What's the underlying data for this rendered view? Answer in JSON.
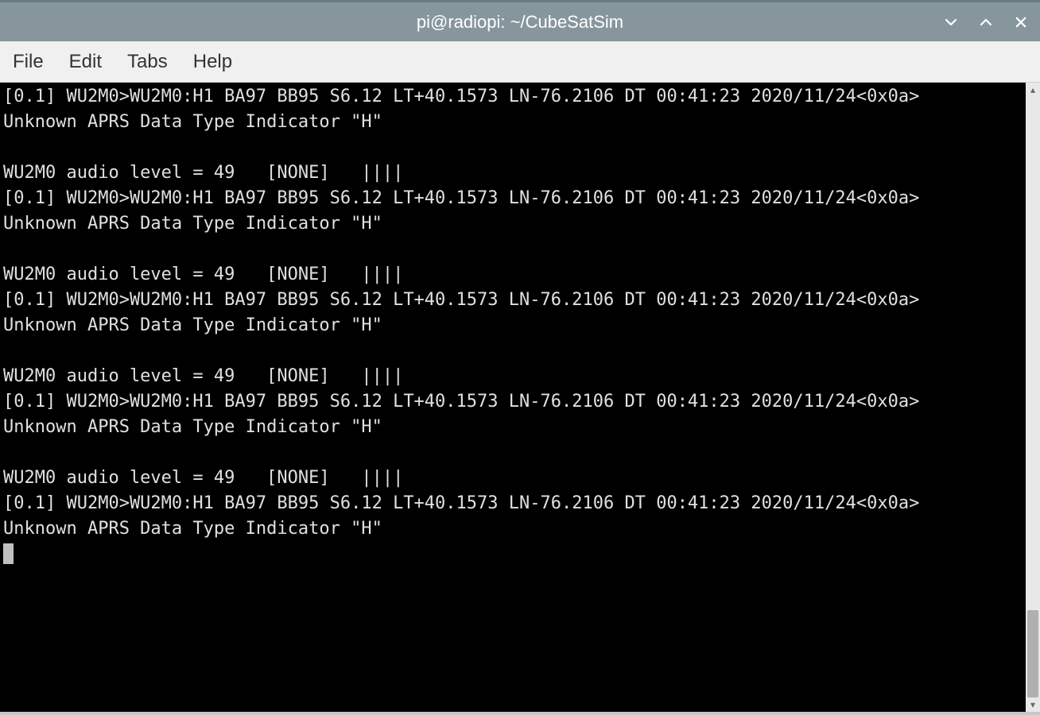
{
  "window": {
    "title": "pi@radiopi: ~/CubeSatSim"
  },
  "menu": {
    "file": "File",
    "edit": "Edit",
    "tabs": "Tabs",
    "help": "Help"
  },
  "terminal": {
    "lines": [
      "[0.1] WU2M0>WU2M0:H1 BA97 BB95 S6.12 LT+40.1573 LN-76.2106 DT 00:41:23 2020/11/24<0x0a>",
      "Unknown APRS Data Type Indicator \"H\"",
      "",
      "WU2M0 audio level = 49   [NONE]   ||||",
      "[0.1] WU2M0>WU2M0:H1 BA97 BB95 S6.12 LT+40.1573 LN-76.2106 DT 00:41:23 2020/11/24<0x0a>",
      "Unknown APRS Data Type Indicator \"H\"",
      "",
      "WU2M0 audio level = 49   [NONE]   ||||",
      "[0.1] WU2M0>WU2M0:H1 BA97 BB95 S6.12 LT+40.1573 LN-76.2106 DT 00:41:23 2020/11/24<0x0a>",
      "Unknown APRS Data Type Indicator \"H\"",
      "",
      "WU2M0 audio level = 49   [NONE]   ||||",
      "[0.1] WU2M0>WU2M0:H1 BA97 BB95 S6.12 LT+40.1573 LN-76.2106 DT 00:41:23 2020/11/24<0x0a>",
      "Unknown APRS Data Type Indicator \"H\"",
      "",
      "WU2M0 audio level = 49   [NONE]   ||||",
      "[0.1] WU2M0>WU2M0:H1 BA97 BB95 S6.12 LT+40.1573 LN-76.2106 DT 00:41:23 2020/11/24<0x0a>",
      "Unknown APRS Data Type Indicator \"H\""
    ]
  }
}
